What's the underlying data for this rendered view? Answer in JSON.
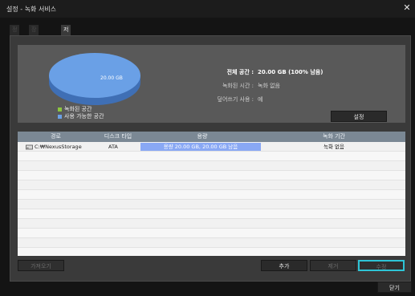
{
  "window": {
    "title": "설정 - 녹화 서비스",
    "close_glyph": "✕"
  },
  "tabs": [
    {
      "label": "정보",
      "active": false
    },
    {
      "label": "장치 설정",
      "active": false
    },
    {
      "label": "저장공간 설정",
      "active": true
    }
  ],
  "chart": {
    "label": "20.00 GB",
    "slices": [
      {
        "name": "녹화된 공간",
        "value": 0,
        "color": "#8cc63f"
      },
      {
        "name": "사용 가능한 공간",
        "value": 100,
        "color": "#6aa0e6"
      }
    ]
  },
  "summary": {
    "total_label": "전체 공간 :",
    "total_value": "20.00 GB (100% 남음)",
    "recorded_label": "녹화된 시간 :",
    "recorded_value": "녹화 없음",
    "overwrite_label": "덮어쓰기 사용 :",
    "overwrite_value": "예",
    "settings_button": "설정"
  },
  "table": {
    "columns": [
      "경로",
      "디스크 타입",
      "용량",
      "녹화 기간"
    ],
    "rows": [
      {
        "path": "C:₩NexusStorage",
        "disk_type": "ATA",
        "capacity": "용량 20.00 GB, 20.00 GB 남음",
        "capacity_free_fraction": 1.0,
        "period": "녹화 없음"
      }
    ],
    "empty_rows": 11
  },
  "buttons": {
    "browse": "가져오기",
    "add": "추가",
    "remove": "제거",
    "edit": "수정",
    "close": "닫기"
  },
  "colors": {
    "accent_focus": "#2ec4d6",
    "recorded": "#8cc63f",
    "available": "#6aa0e6"
  }
}
